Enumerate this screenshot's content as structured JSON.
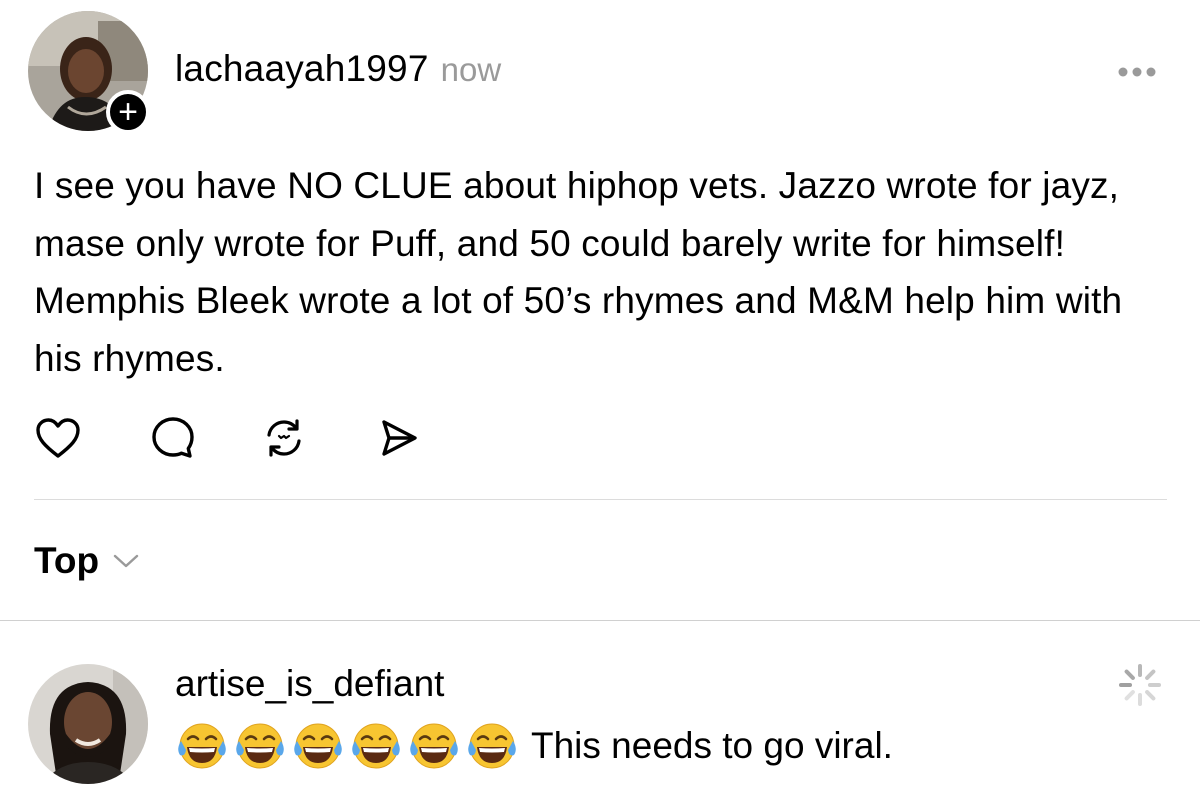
{
  "post": {
    "username": "lachaayah1997",
    "time": "now",
    "more_icon": "more-horizontal-icon",
    "follow_label": "+",
    "body": "I see you have NO CLUE about hiphop vets. Jazzo wrote for jayz, mase only wrote for Puff, and 50 could barely write for himself! Memphis Bleek wrote a lot of 50’s rhymes and M&M help him with his rhymes.",
    "actions": [
      "heart-icon",
      "comment-icon",
      "repost-icon",
      "share-icon"
    ]
  },
  "sort": {
    "label": "Top",
    "icon": "chevron-down-icon"
  },
  "comment": {
    "username": "artise_is_defiant",
    "emoji": "😂",
    "emoji_count": 6,
    "text": "This needs to go viral.",
    "status_icon": "loading-spinner-icon"
  },
  "colors": {
    "text": "#000000",
    "muted": "#9a9a9a",
    "divider": "#dcdcdc"
  }
}
